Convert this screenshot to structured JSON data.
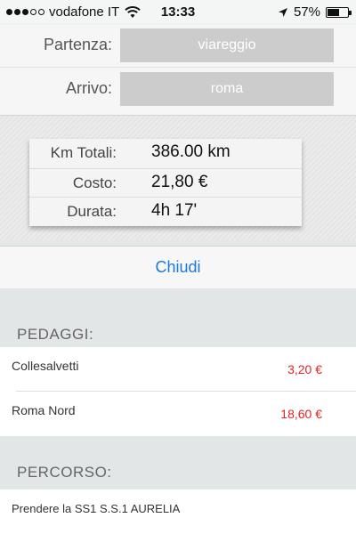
{
  "status_bar": {
    "carrier": "vodafone IT",
    "time": "13:33",
    "battery_percent": "57%",
    "battery_level": 0.57,
    "signal_bars_filled": 3,
    "signal_bars_total": 5
  },
  "route_form": {
    "from_label": "Partenza:",
    "from_value": "viareggio",
    "to_label": "Arrivo:",
    "to_value": "roma"
  },
  "summary": {
    "km_label": "Km Totali:",
    "km_value": "386.00 km",
    "cost_label": "Costo:",
    "cost_value": "21,80 €",
    "duration_label": "Durata:",
    "duration_value": "4h 17'"
  },
  "close_label": "Chiudi",
  "tolls": {
    "header": "PEDAGGI:",
    "items": [
      {
        "name": "Collesalvetti",
        "price": "3,20 €"
      },
      {
        "name": "Roma Nord",
        "price": "18,60 €"
      }
    ]
  },
  "route": {
    "header": "PERCORSO:",
    "items": [
      {
        "text": "Prendere la SS1 S.S.1 AURELIA"
      }
    ]
  },
  "colors": {
    "accent": "#1a7ad8",
    "price": "#e02424",
    "input_bg": "#cccccc"
  }
}
